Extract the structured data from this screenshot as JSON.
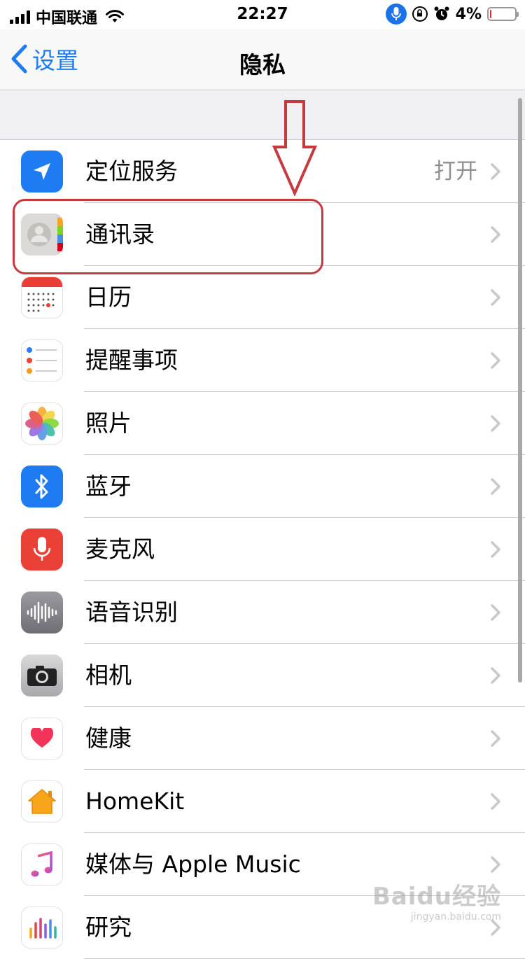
{
  "status_bar": {
    "carrier": "中国联通",
    "time": "22:27",
    "battery": "4%",
    "battery_level": 0.04,
    "icons": [
      "signal-icon",
      "wifi-icon",
      "microphone-icon",
      "rotation-lock-icon",
      "alarm-icon",
      "battery-icon"
    ]
  },
  "nav": {
    "back_label": "设置",
    "title": "隐私"
  },
  "items": [
    {
      "label": "定位服务",
      "detail": "打开",
      "icon": "location-arrow-icon"
    },
    {
      "label": "通讯录",
      "detail": "",
      "icon": "contacts-icon"
    },
    {
      "label": "日历",
      "detail": "",
      "icon": "calendar-icon"
    },
    {
      "label": "提醒事项",
      "detail": "",
      "icon": "reminders-icon"
    },
    {
      "label": "照片",
      "detail": "",
      "icon": "photos-icon"
    },
    {
      "label": "蓝牙",
      "detail": "",
      "icon": "bluetooth-icon"
    },
    {
      "label": "麦克风",
      "detail": "",
      "icon": "microphone-icon"
    },
    {
      "label": "语音识别",
      "detail": "",
      "icon": "speech-recognition-icon"
    },
    {
      "label": "相机",
      "detail": "",
      "icon": "camera-icon"
    },
    {
      "label": "健康",
      "detail": "",
      "icon": "health-heart-icon"
    },
    {
      "label": "HomeKit",
      "detail": "",
      "icon": "homekit-house-icon"
    },
    {
      "label": "媒体与 Apple Music",
      "detail": "",
      "icon": "music-note-icon"
    },
    {
      "label": "研究",
      "detail": "",
      "icon": "research-icon"
    }
  ],
  "colors": {
    "accent": "#1f7bf2",
    "annotation": "#c63a3f",
    "separator": "#c8c7cc",
    "group_background": "#efeff4",
    "detail_text": "#8e8e93"
  },
  "watermark": {
    "main": "Baidu经验",
    "sub": "jingyan.baidu.com"
  }
}
